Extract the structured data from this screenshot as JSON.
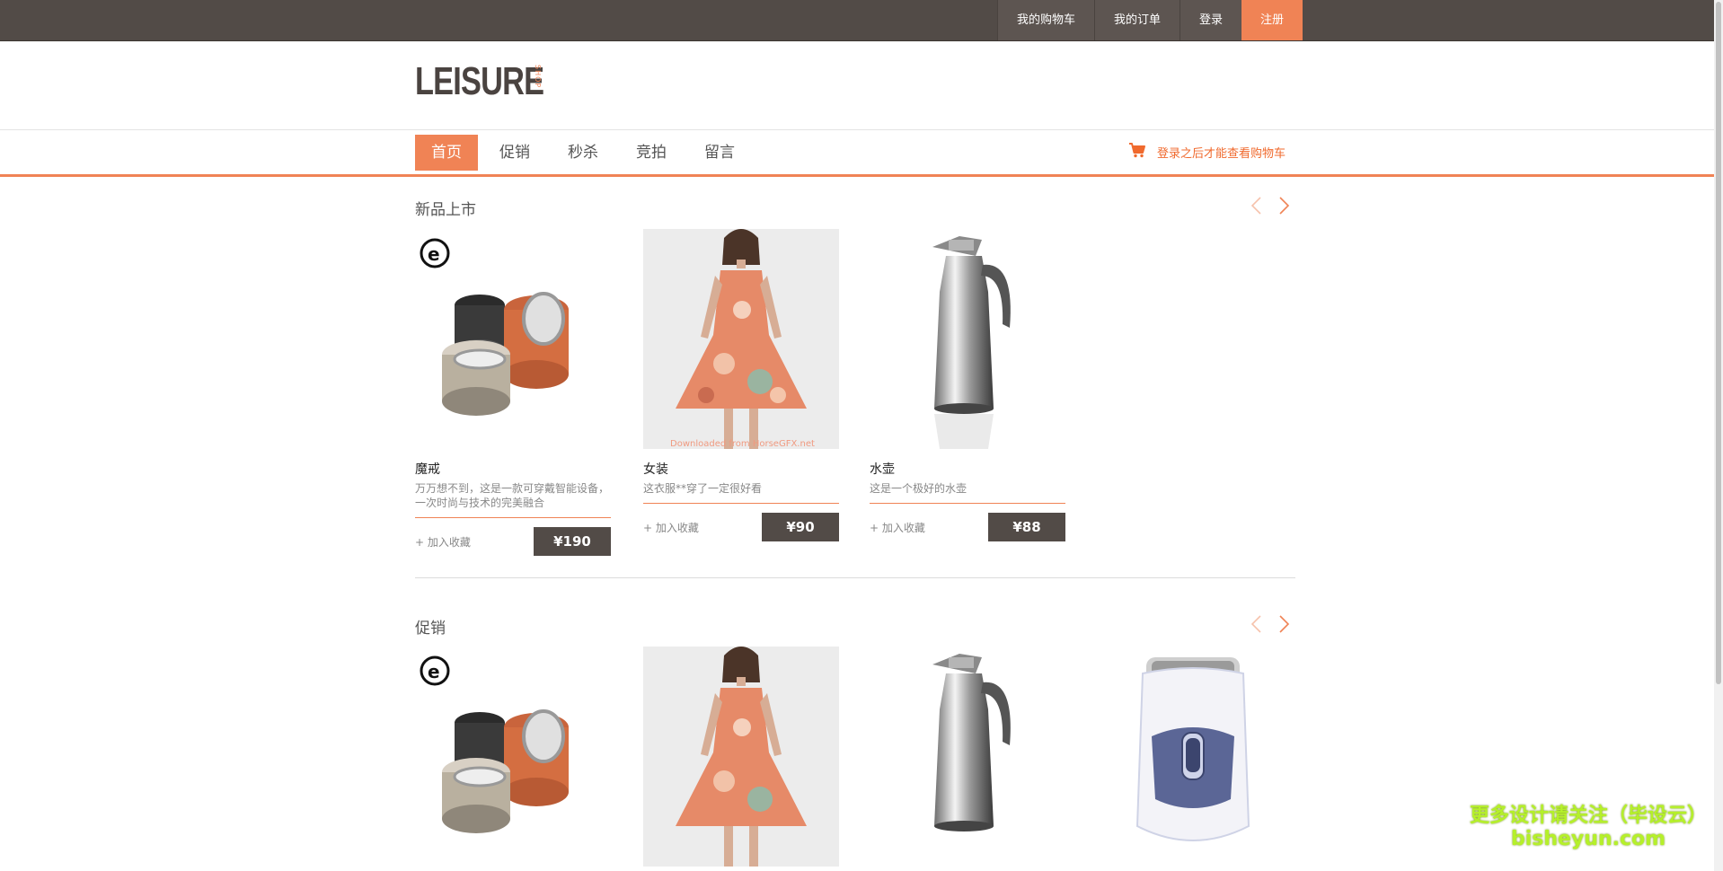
{
  "topnav": {
    "items": [
      {
        "label": "我的购物车"
      },
      {
        "label": "我的订单"
      },
      {
        "label": "登录"
      },
      {
        "label": "注册"
      }
    ]
  },
  "logo": {
    "main": "LEISURE",
    "sub": "SHOP"
  },
  "mainnav": {
    "items": [
      {
        "label": "首页",
        "active": true
      },
      {
        "label": "促销"
      },
      {
        "label": "秒杀"
      },
      {
        "label": "竞拍"
      },
      {
        "label": "留言"
      }
    ],
    "cart_hint": "登录之后才能查看购物车"
  },
  "sections": [
    {
      "title": "新品上市",
      "products": [
        {
          "name": "魔戒",
          "desc": "万万想不到，这是一款可穿戴智能设备，一次时尚与技术的完美融合",
          "fav": "+ 加入收藏",
          "price": "¥190",
          "image": "ring-icon"
        },
        {
          "name": "女装",
          "desc": "这衣服**穿了一定很好看",
          "fav": "+ 加入收藏",
          "price": "¥90",
          "image": "dress-icon"
        },
        {
          "name": "水壶",
          "desc": "这是一个极好的水壶",
          "fav": "+ 加入收藏",
          "price": "¥88",
          "image": "kettle-icon"
        }
      ]
    },
    {
      "title": "促销",
      "products": [
        {
          "image": "ring-icon"
        },
        {
          "image": "dress-icon"
        },
        {
          "image": "kettle-icon"
        },
        {
          "image": "shaver-icon"
        }
      ]
    }
  ],
  "image_watermark": "Downloaded from HorseGFX.net",
  "site_watermark": {
    "line1": "更多设计请关注（毕设云）",
    "line2": "bisheyun.com"
  },
  "colors": {
    "accent": "#f08355",
    "dark": "#524b47"
  }
}
